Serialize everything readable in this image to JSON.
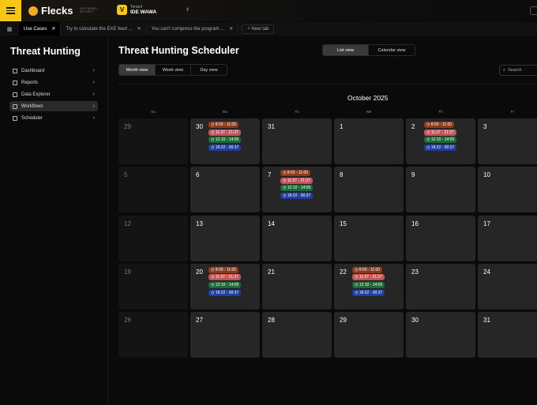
{
  "app": {
    "name": "Flecks",
    "tagline": "FACT-BASED SECURITY",
    "tenant_label": "Tenant",
    "tenant_name": "IDE WAWA",
    "tenant_icon": "V"
  },
  "tabs": [
    {
      "label": "Use Cases",
      "active": true
    },
    {
      "label": "Try to calculate the EXE feed ..."
    },
    {
      "label": "You can't compress the program ..."
    }
  ],
  "new_tab": "+  New tab",
  "sidebar": {
    "title": "Threat Hunting",
    "items": [
      {
        "label": "Dashboard"
      },
      {
        "label": "Reports"
      },
      {
        "label": "Data Explorer"
      },
      {
        "label": "Workflows",
        "selected": true
      },
      {
        "label": "Scheduler"
      }
    ]
  },
  "main": {
    "title": "Threat Hunting Scheduler",
    "view_toggle": [
      "List view",
      "Calendar view"
    ],
    "view_selected": "List view",
    "range_toggle": [
      "Month view",
      "Week view",
      "Day view"
    ],
    "range_selected": "Month view",
    "search_placeholder": "Search",
    "month": "October 2025",
    "weekdays": [
      "Su",
      "Mo",
      "Tu",
      "We",
      "Th",
      "Fr"
    ]
  },
  "event_colors": [
    "#8c3b1e",
    "#c2545c",
    "#1d6a37",
    "#1f3f9e"
  ],
  "event_times": [
    "8:00 - 11:00",
    "11:37 - 21:37",
    "12:10 - 14:05",
    "18:22 - 00:37"
  ],
  "weeks": [
    [
      "29",
      "30",
      "31",
      "1",
      "2",
      "3"
    ],
    [
      "5",
      "6",
      "7",
      "8",
      "9",
      "10"
    ],
    [
      "12",
      "13",
      "14",
      "15",
      "16",
      "17"
    ],
    [
      "19",
      "20",
      "21",
      "22",
      "23",
      "24"
    ],
    [
      "26",
      "27",
      "28",
      "29",
      "30",
      "31"
    ]
  ],
  "days_with_events": [
    [
      0,
      1
    ],
    [
      0,
      4
    ],
    [
      1,
      2
    ],
    [
      3,
      1
    ],
    [
      3,
      3
    ]
  ]
}
